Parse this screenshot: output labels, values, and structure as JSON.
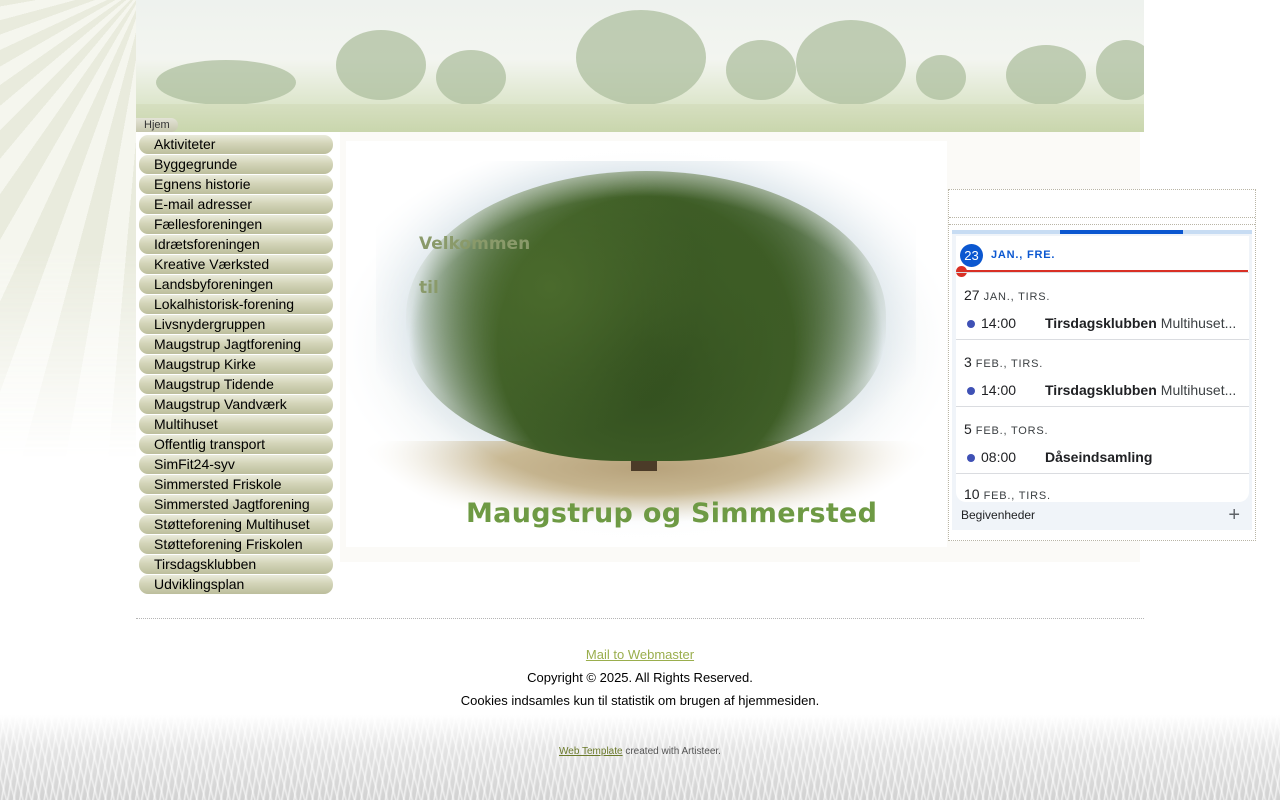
{
  "header": {
    "home_tab": "Hjem"
  },
  "nav": {
    "items": [
      "Aktiviteter",
      "Byggegrunde",
      "Egnens historie",
      "E-mail adresser",
      "Fællesforeningen",
      "Idrætsforeningen",
      "Kreative Værksted",
      "Landsbyforeningen",
      "Lokalhistorisk-forening",
      "Livsnydergruppen",
      "Maugstrup Jagtforening",
      "Maugstrup Kirke",
      "Maugstrup Tidende",
      "Maugstrup Vandværk",
      "Multihuset",
      "Offentlig transport",
      "SimFit24-syv",
      "Simmersted Friskole",
      "Simmersted Jagtforening",
      "Støtteforening Multihuset",
      "Støtteforening Friskolen",
      "Tirsdagsklubben",
      "Udviklingsplan"
    ]
  },
  "welcome": {
    "line1": "Velkommen",
    "line2": "til",
    "site_name": "Maugstrup og Simmersted"
  },
  "calendar": {
    "today": {
      "day": "23",
      "label": "JAN., FRE."
    },
    "days": [
      {
        "num": "27",
        "name": "JAN., TIRS.",
        "time": "14:00",
        "title": "Tirsdagsklubben",
        "location": "Multihuset..."
      },
      {
        "num": "3",
        "name": "FEB., TIRS.",
        "time": "14:00",
        "title": "Tirsdagsklubben",
        "location": "Multihuset..."
      },
      {
        "num": "5",
        "name": "FEB., TORS.",
        "time": "08:00",
        "title": "Dåseindsamling",
        "location": ""
      },
      {
        "num": "10",
        "name": "FEB., TIRS.",
        "time": "",
        "title": "",
        "location": ""
      }
    ],
    "footer_label": "Begivenheder",
    "add_symbol": "+",
    "colors": {
      "accent": "#0b57d0",
      "now_line": "#d93025",
      "event_dot": "#3f51b5"
    }
  },
  "footer": {
    "mail_link": "Mail to Webmaster",
    "copyright": "Copyright © 2025. All Rights Reserved.",
    "cookies": "Cookies indsamles kun til statistik om brugen af hjemmesiden."
  },
  "credits": {
    "link": "Web Template",
    "text": " created with Artisteer."
  },
  "colors": {
    "nav_button": "#d3d4b8",
    "link_green": "#9aae4d",
    "site_name_green": "#6e9a44"
  }
}
